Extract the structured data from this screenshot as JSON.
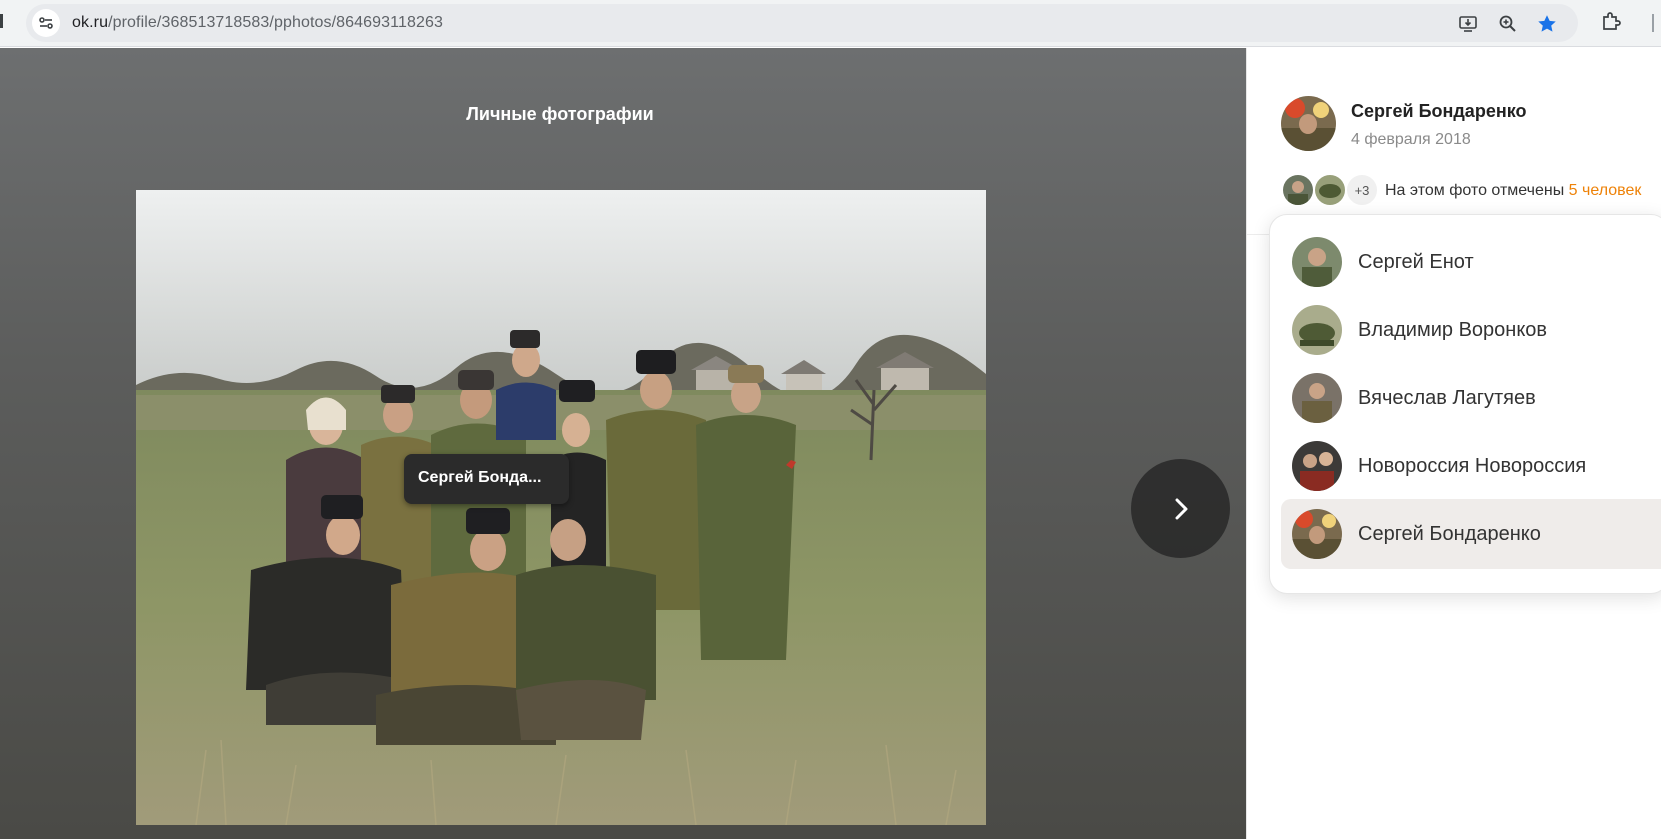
{
  "browser": {
    "url_host": "ok.ru",
    "url_path": "/profile/368513718583/pphotos/864693118263",
    "icons": [
      "site-settings-icon",
      "install-app-icon",
      "zoom-icon",
      "bookmark-star-icon",
      "extensions-icon"
    ],
    "bookmark_color": "#1a73e8"
  },
  "viewer": {
    "album_title": "Личные фотографии",
    "tooltip_name": "Сергей Бонда...",
    "next_icon": "chevron-right-icon"
  },
  "panel": {
    "author_name": "Сергей Бондаренко",
    "post_date": "4 февраля 2018",
    "tag_more": "+3",
    "tagged_text": "На этом фото отмечены ",
    "tagged_count": "5 человек",
    "accent": "#ee8208",
    "tagged_people": [
      {
        "name": "Сергей Енот"
      },
      {
        "name": "Владимир Воронков"
      },
      {
        "name": "Вячеслав Лагутяев"
      },
      {
        "name": "Новороссия Новороссия"
      },
      {
        "name": "Сергей Бондаренко",
        "selected": true
      }
    ]
  }
}
